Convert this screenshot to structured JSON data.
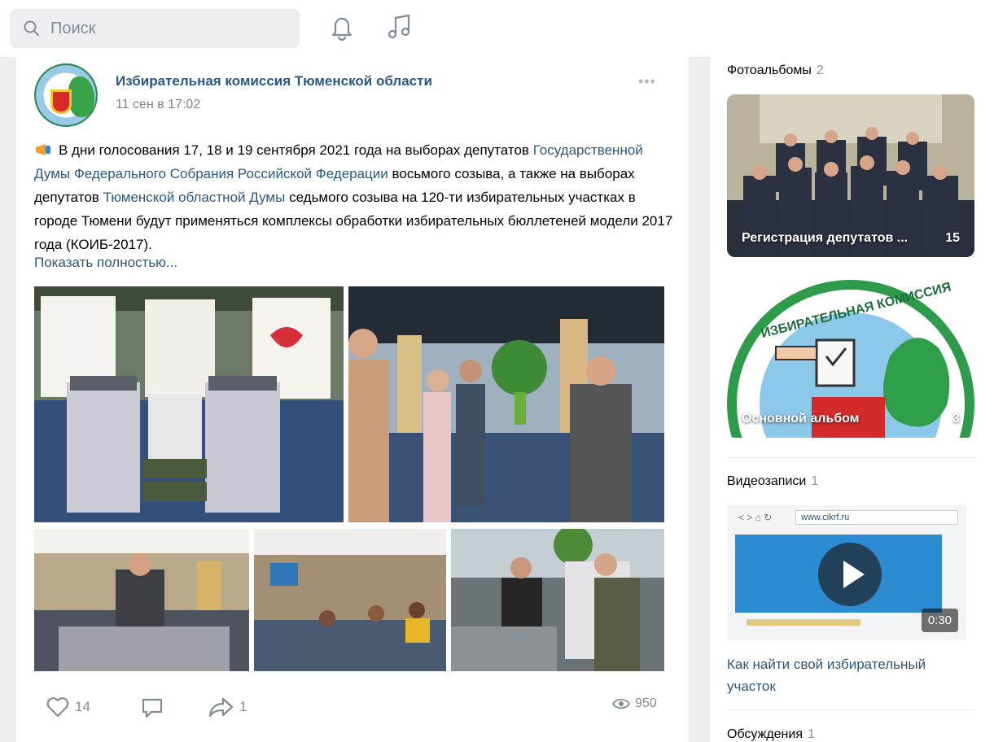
{
  "search": {
    "placeholder": "Поиск"
  },
  "header_icons": [
    "bell-icon",
    "music-icon"
  ],
  "post": {
    "author": "Избирательная комиссия Тюменской области",
    "date": "11 сен в 17:02",
    "more": "•••",
    "text_parts": {
      "p1": "В дни голосования 17, 18 и 19 сентября 2021 года на выборах депутатов",
      "link1": "Государственной Думы Федерального Собрания Российской Федерации",
      "p2": " восьмого созыва, а также на выборах депутатов ",
      "link2": "Тюменской областной Думы",
      "p3": " седьмого созыва на 120-ти избирательных участках в городе Тюмени будут применяться комплексы обработки избирательных бюллетеней модели 2017 года (КОИБ-2017)."
    },
    "show_more": "Показать полностью...",
    "likes": "14",
    "reposts": "1",
    "views": "950"
  },
  "sidebar": {
    "photoalbums": {
      "title": "Фотоальбомы",
      "count": "2"
    },
    "albums": [
      {
        "label": "Регистрация депутатов ...",
        "count": "15"
      },
      {
        "label": "Основной альбом",
        "count": "3"
      }
    ],
    "videos": {
      "title": "Видеозаписи",
      "count": "1"
    },
    "video": {
      "duration": "0:30",
      "title": "Как найти свой избирательный участок",
      "url_text": "www.cikrf.ru"
    },
    "discussions": {
      "title": "Обсуждения",
      "count": "1"
    }
  },
  "colors": {
    "link": "#2a5885",
    "muted": "#818c99",
    "bg": "#edeef0"
  }
}
